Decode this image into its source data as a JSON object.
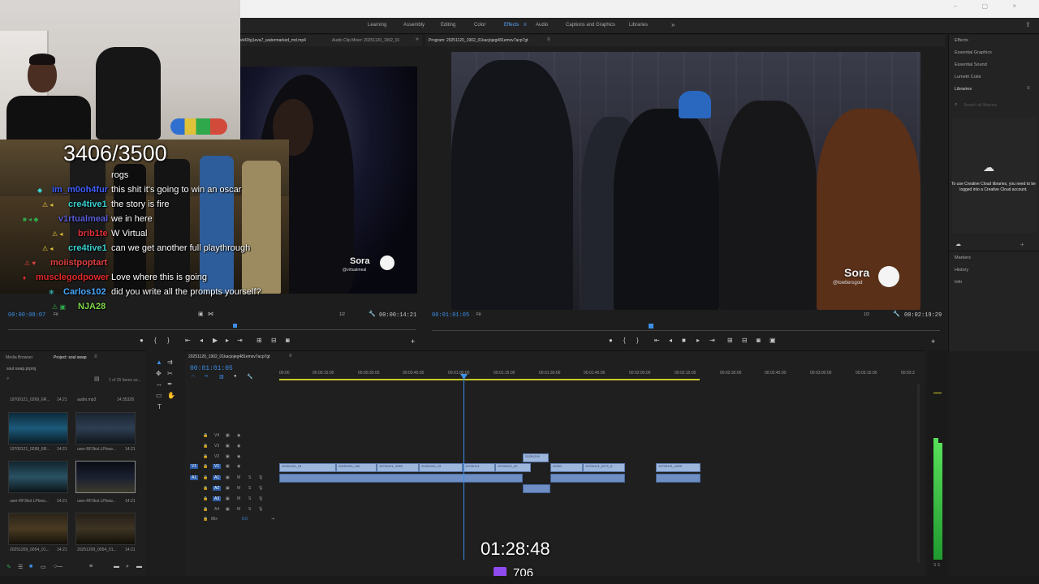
{
  "app": {
    "window_controls": "– ▢ ×"
  },
  "workspaces": [
    {
      "label": "Learning",
      "active": false
    },
    {
      "label": "Assembly",
      "active": false
    },
    {
      "label": "Editing",
      "active": false
    },
    {
      "label": "Color",
      "active": false
    },
    {
      "label": "Effects",
      "active": true
    },
    {
      "label": "Audio",
      "active": false
    },
    {
      "label": "Captions and Graphics",
      "active": false
    },
    {
      "label": "Libraries",
      "active": false
    }
  ],
  "workspaces_more": "»",
  "source_monitor": {
    "tab_source": "vk43tg1eva7_watermarked_md.mp4",
    "tab_audio_mixer": "Audio Clip Mixer: 20251120_1902_01",
    "timecode_in": "00:00:08:07",
    "fit": "Fit",
    "resolution": "1/2",
    "duration": "00:00:14:21",
    "watermark_brand": "Sora",
    "watermark_handle": "@virtualmeal"
  },
  "program_monitor": {
    "tab": "Program: 20251120_1902_01kacjojeg481emxv7acp7gt",
    "timecode": "00:01:01:05",
    "fit": "Fit",
    "resolution": "1/2",
    "duration": "00:02:19:29",
    "watermark_brand": "Sora",
    "watermark_handle": "@lowtiersgod"
  },
  "overlay": {
    "counter": "3406/3500"
  },
  "chat": [
    {
      "name": "",
      "message": "rogs",
      "color": "#ffffff"
    },
    {
      "name": "im_m0oh4fur",
      "message": "this shit it's going to win an oscar",
      "color": "#3f5fff"
    },
    {
      "name": "cre4tive1",
      "message": "the story is fire",
      "color": "#3ad1d1"
    },
    {
      "name": "v1rtualmeal",
      "message": "we in here",
      "color": "#5a5fd8"
    },
    {
      "name": "brib1te",
      "message": "W Virtual",
      "color": "#e0303a"
    },
    {
      "name": "cre4tive1",
      "message": "can we get another full playthrough",
      "color": "#3ad1d1"
    },
    {
      "name": "moiistpoptart",
      "message": "",
      "color": "#e04040"
    },
    {
      "name": "musclegodpower",
      "message": "Love where this is going",
      "color": "#e02a2a"
    },
    {
      "name": "Carlos102",
      "message": "did you write all the prompts yourself?",
      "color": "#4aa8ff"
    },
    {
      "name": "NJA28",
      "message": "",
      "color": "#7fd84a"
    }
  ],
  "right_panel": {
    "effects": "Effects",
    "essential_graphics": "Essential Graphics",
    "essential_sound": "Essential Sound",
    "lumetri_color": "Lumetri Color",
    "libraries": "Libraries",
    "search_placeholder": "Search all libraries",
    "cc_message": "To use Creative Cloud libraries, you need to be logged into a Creative Cloud account.",
    "markers": "Markers",
    "history": "History",
    "info": "Info"
  },
  "project_panel": {
    "tab_media_browser": "Media Browser",
    "tab_project": "Project: soul swap",
    "project_file": "soul swap.prproj",
    "items_count": "1 of 25 Items se...",
    "items": [
      {
        "name": "19700121_0269_6R...",
        "duration": "14:21"
      },
      {
        "name": "audio.mp3",
        "duration": "14:35328"
      },
      {
        "name": "19700121_0268_6R...",
        "duration": "14:21"
      },
      {
        "name": "user-RF3kol.LPbow...",
        "duration": "14:21"
      },
      {
        "name": "user-RF3kol.LPbow...",
        "duration": "14:21"
      },
      {
        "name": "user-RF3kol.LPbow...",
        "duration": "14:21"
      },
      {
        "name": "20251209_0054_01...",
        "duration": "14:21"
      },
      {
        "name": "20251209_0054_01...",
        "duration": "14:21"
      }
    ]
  },
  "timeline": {
    "sequence_tab": "20251120_1902_01kacjojeg481emxv7acp7gt",
    "timecode": "00:01:01:05",
    "ruler": [
      "00:00",
      "00:00:15:00",
      "00:00:30:00",
      "00:00:45:00",
      "00:01:00:00",
      "00:01:15:00",
      "00:01:30:00",
      "00:01:45:00",
      "00:02:00:00",
      "00:02:15:00",
      "00:02:30:00",
      "00:02:45:00",
      "00:03:00:00",
      "00:03:15:00",
      "00:03:3"
    ],
    "video_tracks": [
      "V4",
      "V3",
      "V2",
      "V1"
    ],
    "audio_tracks": [
      "A1",
      "A2",
      "A3",
      "A4"
    ],
    "mix_label": "Mix",
    "mix_value": "0.0",
    "clip_labels": [
      "20251120_18",
      "20251120_190",
      "19700121_0269",
      "20251120_19",
      "19700121",
      "19700121_02",
      "20251",
      "20251209",
      "19700121_0271_6",
      "19700121_0259"
    ]
  },
  "stream": {
    "timer": "01:28:48",
    "viewers": "706"
  },
  "meter_scale": "S S"
}
